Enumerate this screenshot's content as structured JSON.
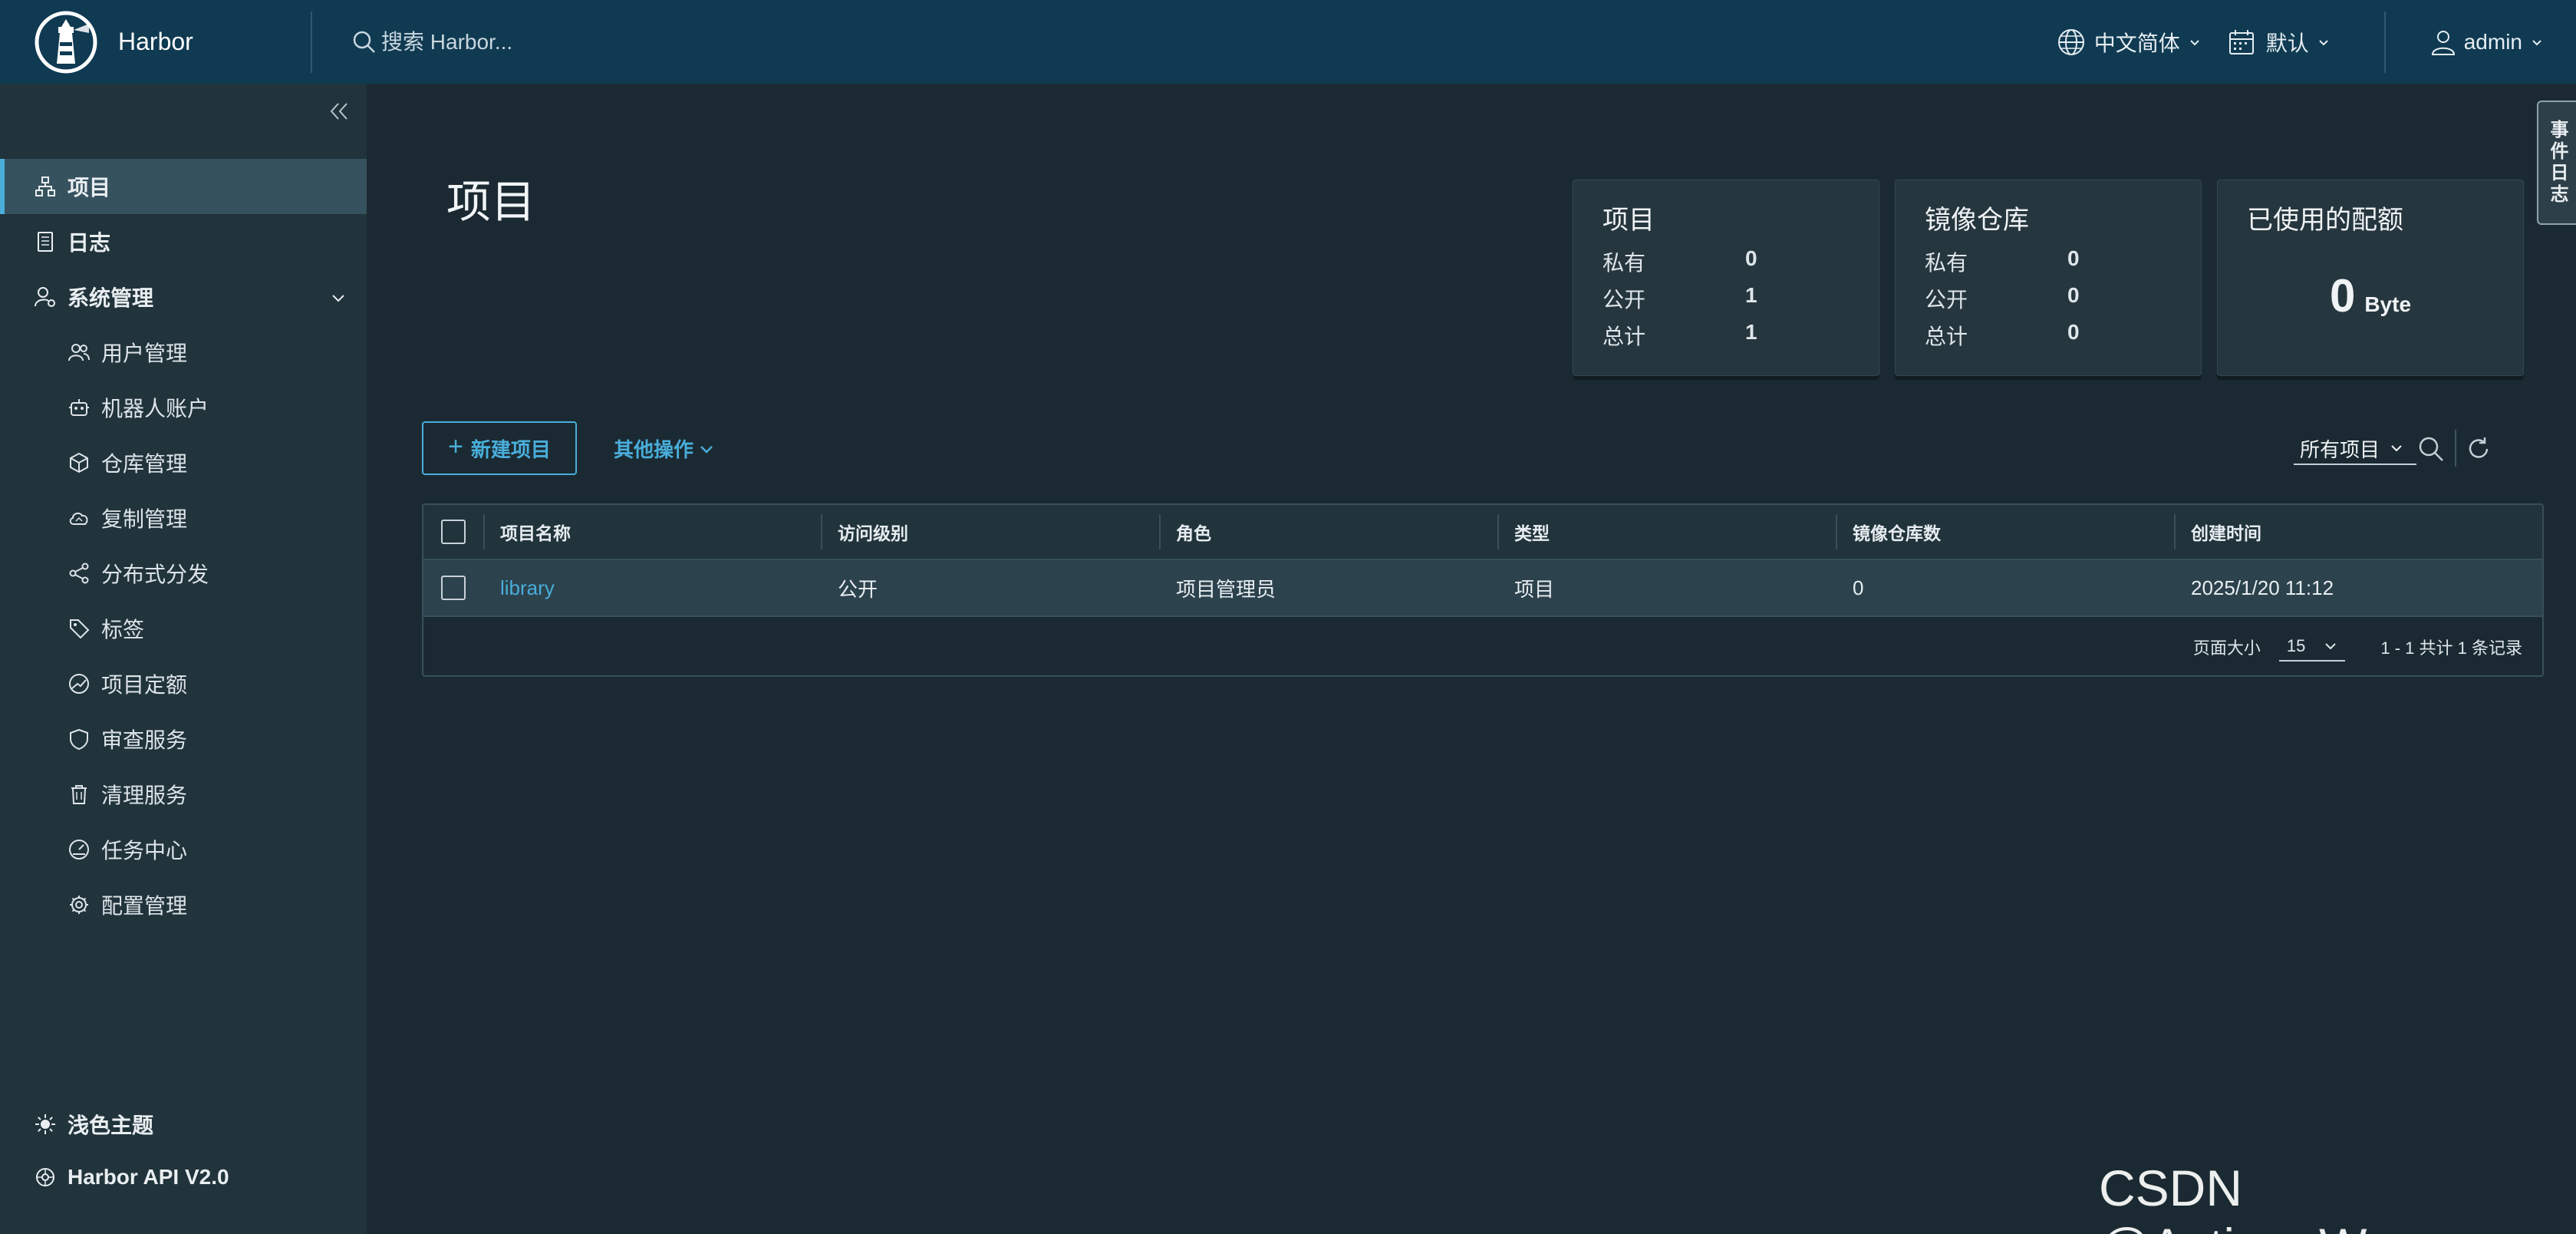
{
  "header": {
    "brand": "Harbor",
    "search_placeholder": "搜索 Harbor...",
    "language": "中文简体",
    "theme_select": "默认",
    "user": "admin"
  },
  "sidebar": {
    "items": [
      {
        "label": "项目",
        "icon": "projects-icon",
        "active": true
      },
      {
        "label": "日志",
        "icon": "logs-icon"
      },
      {
        "label": "系统管理",
        "icon": "admin-icon",
        "expanded": true
      },
      {
        "label": "用户管理",
        "icon": "users-icon"
      },
      {
        "label": "机器人账户",
        "icon": "robot-icon"
      },
      {
        "label": "仓库管理",
        "icon": "registry-icon"
      },
      {
        "label": "复制管理",
        "icon": "cloud-replication-icon"
      },
      {
        "label": "分布式分发",
        "icon": "share-icon"
      },
      {
        "label": "标签",
        "icon": "tag-icon"
      },
      {
        "label": "项目定额",
        "icon": "quota-icon"
      },
      {
        "label": "审查服务",
        "icon": "shield-icon"
      },
      {
        "label": "清理服务",
        "icon": "trash-icon"
      },
      {
        "label": "任务中心",
        "icon": "dashboard-icon"
      },
      {
        "label": "配置管理",
        "icon": "gear-icon"
      }
    ],
    "light_theme": "浅色主题",
    "api": "Harbor API V2.0"
  },
  "main": {
    "title": "项目",
    "cards": {
      "projects": {
        "title": "项目",
        "private_label": "私有",
        "private": "0",
        "public_label": "公开",
        "public": "1",
        "total_label": "总计",
        "total": "1"
      },
      "repos": {
        "title": "镜像仓库",
        "private_label": "私有",
        "private": "0",
        "public_label": "公开",
        "public": "0",
        "total_label": "总计",
        "total": "0"
      },
      "quota": {
        "title": "已使用的配额",
        "value": "0",
        "unit": "Byte"
      }
    },
    "new_project": "新建项目",
    "other_ops": "其他操作",
    "filter": "所有项目"
  },
  "table": {
    "headers": [
      "项目名称",
      "访问级别",
      "角色",
      "类型",
      "镜像仓库数",
      "创建时间"
    ],
    "rows": [
      {
        "name": "library",
        "access": "公开",
        "role": "项目管理员",
        "type": "项目",
        "repo_count": "0",
        "created": "2025/1/20 11:12"
      }
    ],
    "footer": {
      "page_size_label": "页面大小",
      "page_size": "15",
      "summary": "1 - 1 共计 1 条记录"
    }
  },
  "side_tab": "事件日志",
  "watermark": "CSDN @Action_Wang",
  "colors": {
    "header_bg": "#0f3a52",
    "sidebar_bg": "#21333b",
    "body_bg": "#1b2a32",
    "accent": "#49aeda"
  }
}
